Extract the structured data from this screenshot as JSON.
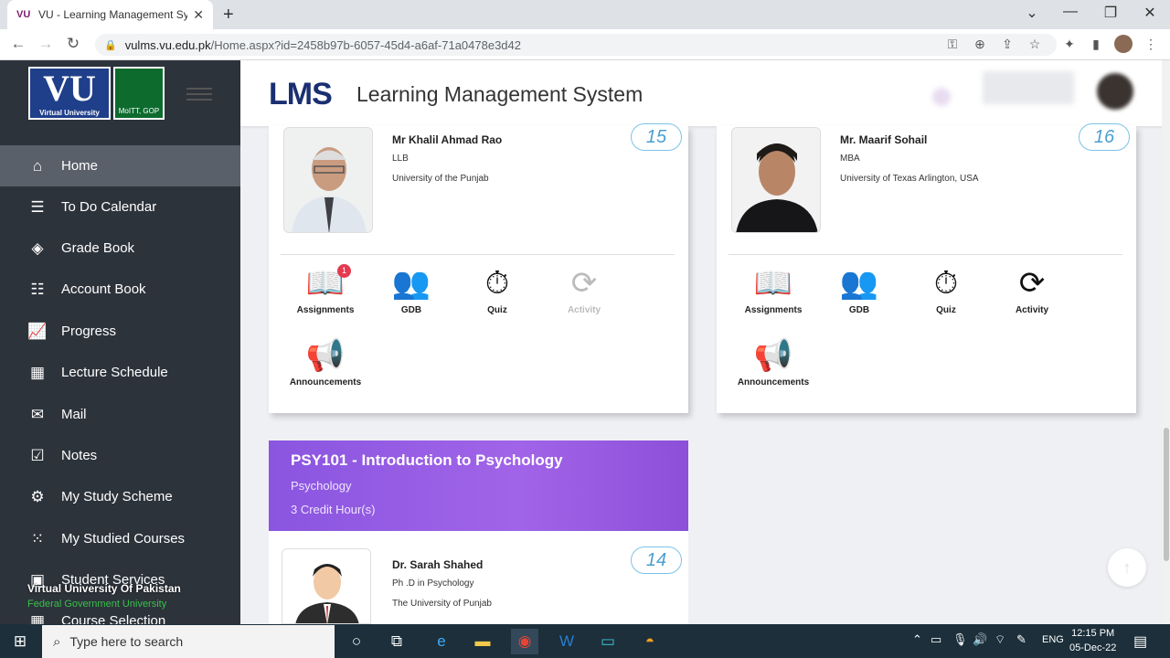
{
  "browser": {
    "tab_title": "VU - Learning Management Syst",
    "tab_favicon": "VU",
    "url_host": "vulms.vu.edu.pk",
    "url_path": "/Home.aspx?id=2458b97b-6057-45d4-a6af-71a0478e3d42"
  },
  "sidebar": {
    "logo_text": "VU",
    "logo_caption": "Virtual University",
    "gov_caption": "MoITT, GOP",
    "items": [
      {
        "label": "Home",
        "icon": "home-icon"
      },
      {
        "label": "To Do Calendar",
        "icon": "list-icon"
      },
      {
        "label": "Grade Book",
        "icon": "layers-icon"
      },
      {
        "label": "Account Book",
        "icon": "sliders-icon"
      },
      {
        "label": "Progress",
        "icon": "chart-icon"
      },
      {
        "label": "Lecture Schedule",
        "icon": "calendar-icon"
      },
      {
        "label": "Mail",
        "icon": "mail-icon"
      },
      {
        "label": "Notes",
        "icon": "checklist-icon"
      },
      {
        "label": "My Study Scheme",
        "icon": "gear-icon"
      },
      {
        "label": "My Studied Courses",
        "icon": "grid-icon"
      },
      {
        "label": "Student Services",
        "icon": "briefcase-icon"
      },
      {
        "label": "Course Selection",
        "icon": "calendar-icon"
      }
    ],
    "university_name": "Virtual University Of Pakistan",
    "university_sub": "Federal Government University"
  },
  "header": {
    "logo": "LMS",
    "title": "Learning Management System"
  },
  "cards": [
    {
      "teacher": "Mr Khalil Ahmad Rao",
      "degree": "LLB",
      "university": "University of the Punjab",
      "badge": "15",
      "tools": [
        {
          "label": "Assignments",
          "enabled": true,
          "notification": "1"
        },
        {
          "label": "GDB",
          "enabled": true
        },
        {
          "label": "Quiz",
          "enabled": true
        },
        {
          "label": "Activity",
          "enabled": false
        },
        {
          "label": "Announcements",
          "enabled": true
        }
      ]
    },
    {
      "teacher": "Mr. Maarif Sohail",
      "degree": "MBA",
      "university": "University of Texas Arlington, USA",
      "badge": "16",
      "tools": [
        {
          "label": "Assignments",
          "enabled": true
        },
        {
          "label": "GDB",
          "enabled": true
        },
        {
          "label": "Quiz",
          "enabled": true
        },
        {
          "label": "Activity",
          "enabled": true
        },
        {
          "label": "Announcements",
          "enabled": true
        }
      ]
    },
    {
      "course_title": "PSY101 - Introduction to Psychology",
      "course_subject": "Psychology",
      "credit_hours": "3 Credit Hour(s)",
      "teacher": "Dr. Sarah Shahed",
      "degree": "Ph .D in Psychology",
      "university": "The University of Punjab",
      "badge": "14"
    }
  ],
  "taskbar": {
    "search_placeholder": "Type here to search",
    "language": "ENG",
    "time": "12:15 PM",
    "date": "05-Dec-22"
  },
  "colors": {
    "sidebar_bg": "#2d333b",
    "banner": "#8a55e0",
    "badge": "#4a9fd2"
  }
}
